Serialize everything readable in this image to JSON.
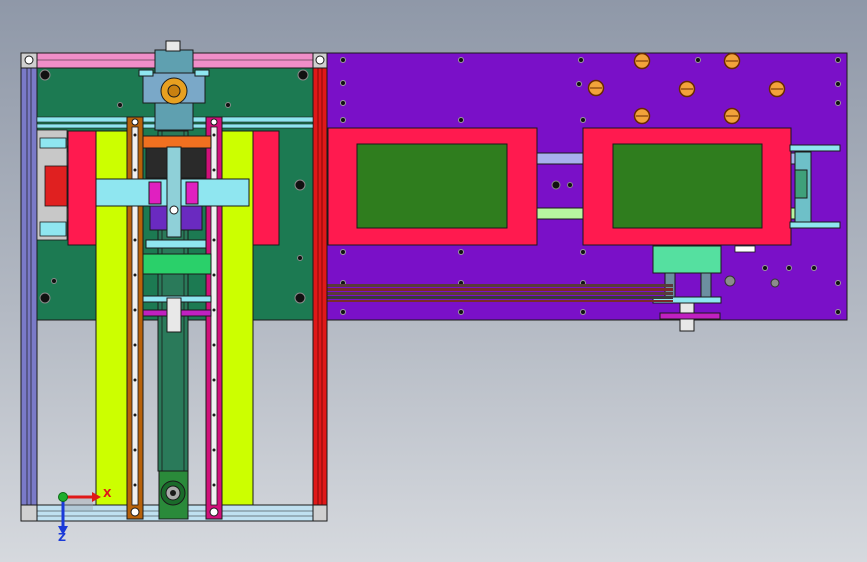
{
  "view": {
    "kind": "cad-top-view",
    "background": "gradient-grey"
  },
  "palette": {
    "left_plate": "#1c7a52",
    "right_plate": "#7a10c8",
    "red_frame": "#ff1a4f",
    "green_window": "#2f7d1e",
    "lime_rail": "#ccff00",
    "orange_rail": "#b8620a",
    "magenta_rail": "#d1107a",
    "cyan_bracket": "#8fe6f0",
    "column_red": "#e01818",
    "outline": "#1a1a1a"
  },
  "axis_triad": {
    "x_label": "X",
    "z_label": "Z",
    "x_color": "#e01818",
    "z_color": "#1a3ad8",
    "y_color": "#1fae2c"
  },
  "parts": [
    {
      "name": "left-base-plate",
      "label": ""
    },
    {
      "name": "right-base-plate",
      "label": ""
    },
    {
      "name": "left-tray-window",
      "label": ""
    },
    {
      "name": "right-tray-window",
      "label": ""
    },
    {
      "name": "vertical-lift-rails",
      "label": ""
    },
    {
      "name": "gripper-carriage",
      "label": ""
    },
    {
      "name": "motor-pulley",
      "label": ""
    },
    {
      "name": "drive-belt-bundle",
      "label": ""
    }
  ]
}
